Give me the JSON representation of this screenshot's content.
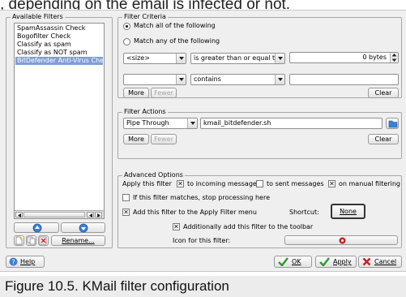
{
  "top_caption": ", depending on the email is infected or not.",
  "available_filters": {
    "title": "Available Filters",
    "items": [
      {
        "label": "SpamAssassin Check",
        "selected": false
      },
      {
        "label": "Bogofilter Check",
        "selected": false
      },
      {
        "label": "Classify as spam",
        "selected": false
      },
      {
        "label": "Classify as NOT spam",
        "selected": false
      },
      {
        "label": "BitDefender Anti-Virus Checl",
        "selected": true
      }
    ],
    "rename_button": "Rename..."
  },
  "filter_criteria": {
    "title": "Filter Criteria",
    "match_all": "Match all of the following",
    "match_any": "Match any of the following",
    "match_mode": "all",
    "rules": [
      {
        "field": "<size>",
        "condition": "is greater than or equal to",
        "value": "0 bytes"
      },
      {
        "field": "",
        "condition": "contains",
        "value": ""
      }
    ],
    "more_button": "More",
    "fewer_button": "Fewer",
    "clear_button": "Clear"
  },
  "filter_actions": {
    "title": "Filter Actions",
    "action": "Pipe Through",
    "argument": "kmail_bitdefender.sh",
    "more_button": "More",
    "fewer_button": "Fewer",
    "clear_button": "Clear"
  },
  "advanced_options": {
    "title": "Advanced Options",
    "apply_label": "Apply this filter",
    "incoming_label": "to incoming messages",
    "incoming_checked": true,
    "sent_label": "to sent messages",
    "sent_checked": false,
    "manual_label": "on manual filtering",
    "manual_checked": true,
    "stop_label": "If this filter matches, stop processing here",
    "stop_checked": false,
    "apply_menu_label": "Add this filter to the Apply Filter menu",
    "apply_menu_checked": true,
    "shortcut_label": "Shortcut:",
    "shortcut_value": "None",
    "toolbar_label": "Additionally add this filter to the toolbar",
    "toolbar_checked": true,
    "icon_label": "Icon for this filter:"
  },
  "dialog_buttons": {
    "help": "Help",
    "ok": "OK",
    "apply": "Apply",
    "cancel": "Cancel"
  },
  "figure_caption": "Figure 10.5. KMail filter configuration",
  "colors": {
    "selection": "#7f9ed3",
    "help_icon": "#3d7fd6",
    "ok_check": "#2d9a2d",
    "cancel_x": "#d02020",
    "filter_icon": "#cc2222"
  }
}
